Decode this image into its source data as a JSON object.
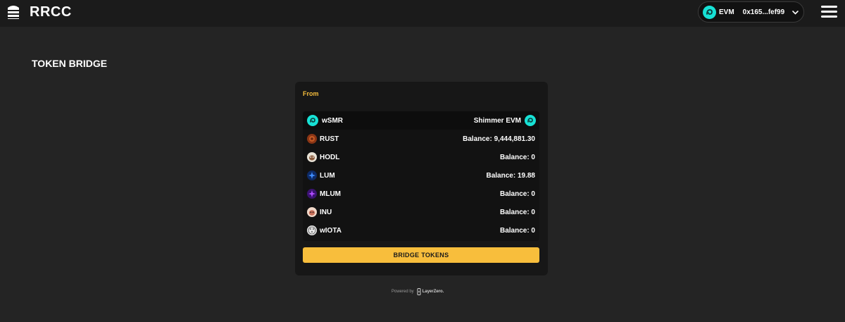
{
  "app": {
    "brand": "RRCC"
  },
  "header": {
    "network_label": "EVM",
    "wallet_address": "0x165...fef99"
  },
  "page": {
    "title": "TOKEN BRIDGE"
  },
  "bridge": {
    "from_label": "From",
    "selected_token": {
      "name": "wSMR",
      "chain": "Shimmer EVM",
      "icon": "shimmer-icon"
    },
    "tokens": [
      {
        "name": "RUST",
        "balance": "Balance: 9,444,881.30",
        "icon": "rust-token-icon"
      },
      {
        "name": "HODL",
        "balance": "Balance: 0",
        "icon": "hodl-token-icon"
      },
      {
        "name": "LUM",
        "balance": "Balance: 19.88",
        "icon": "lum-token-icon"
      },
      {
        "name": "MLUM",
        "balance": "Balance: 0",
        "icon": "mlum-token-icon"
      },
      {
        "name": "INU",
        "balance": "Balance: 0",
        "icon": "inu-token-icon"
      },
      {
        "name": "wIOTA",
        "balance": "Balance: 0",
        "icon": "wiota-token-icon"
      }
    ],
    "button_label": "BRIDGE TOKENS"
  },
  "footer": {
    "powered_by": "Powered by",
    "provider": "LayerZero."
  },
  "colors": {
    "accent": "#f8be3c",
    "background": "#242424",
    "topbar": "#1b1b1b",
    "card": "#171717",
    "shimmer": "#17e1d5"
  }
}
